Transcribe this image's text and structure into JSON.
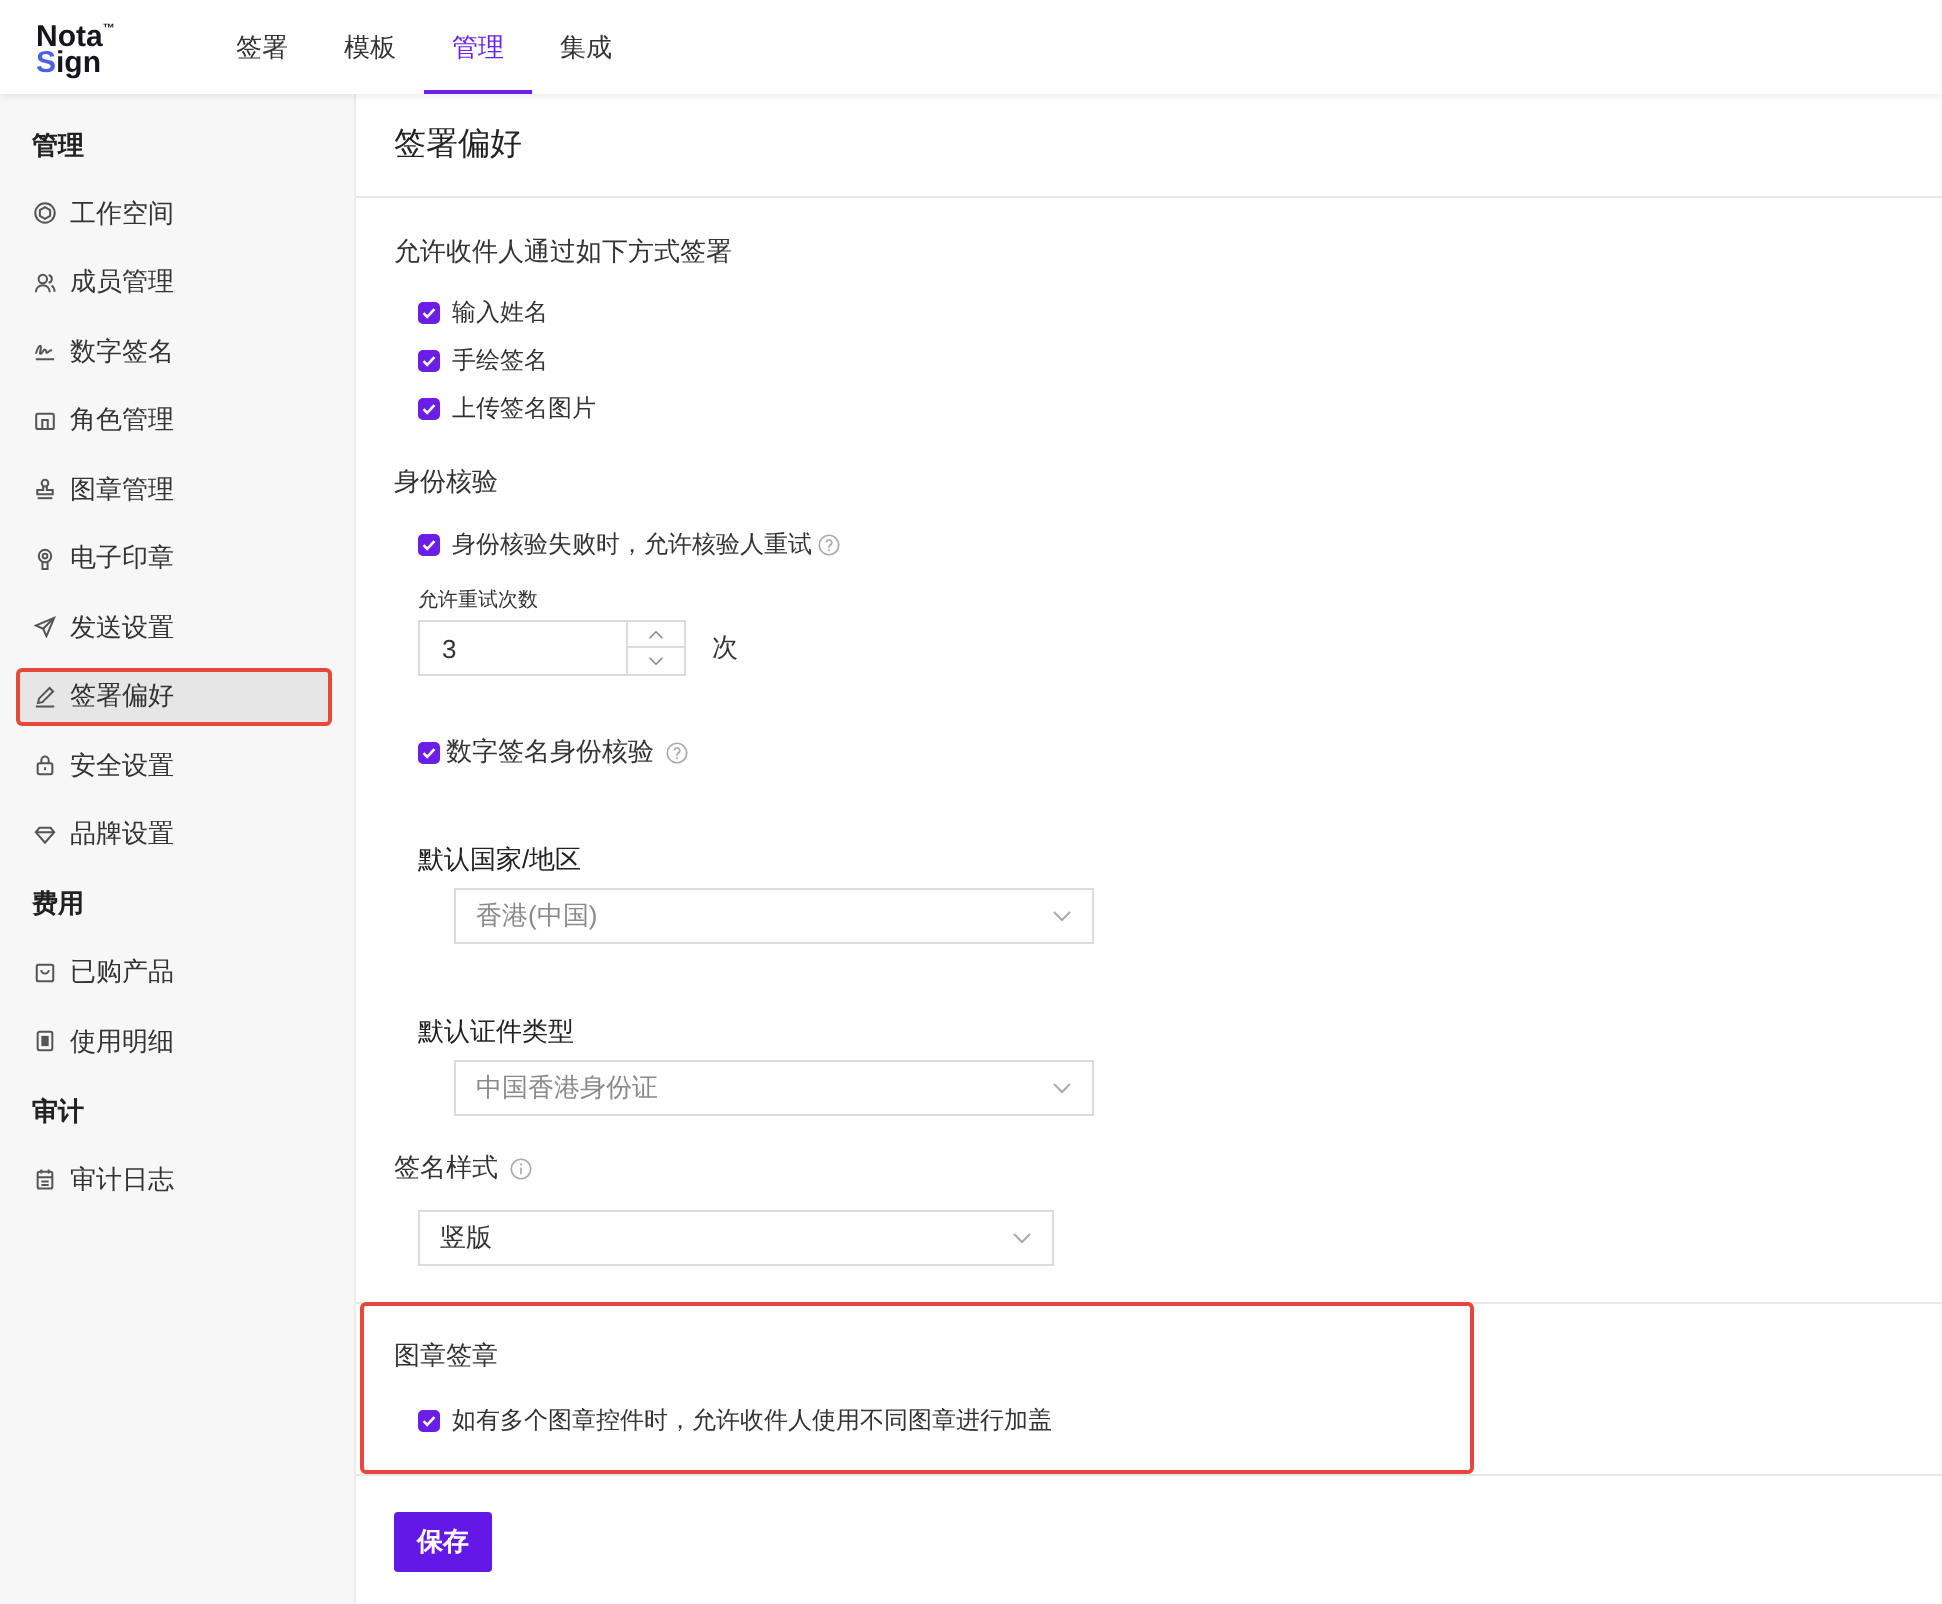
{
  "logo": {
    "line_1": "Nota$^{™}$",
    "line_2": "Sign"
  },
  "nav": [
    {
      "label": "签署",
      "selected": false
    },
    {
      "label": "模板",
      "selected": false
    },
    {
      "label": "管理",
      "selected": true
    },
    {
      "label": "集成",
      "selected": false
    }
  ],
  "sidebar": {
    "groups": [
      {
        "title": "管理",
        "items": [
          {
            "label": "工作空间",
            "selected": false,
            "highlighted": false
          },
          {
            "label": "成员管理",
            "selected": false,
            "highlighted": false
          },
          {
            "label": "数字签名",
            "selected": false,
            "highlighted": false
          },
          {
            "label": "角色管理",
            "selected": false,
            "highlighted": false
          },
          {
            "label": "图章管理",
            "selected": false,
            "highlighted": false
          },
          {
            "label": "电子印章",
            "selected": false,
            "highlighted": false
          },
          {
            "label": "发送设置",
            "selected": false,
            "highlighted": false
          },
          {
            "label": "签署偏好",
            "selected": true,
            "highlighted": true
          },
          {
            "label": "安全设置",
            "selected": false,
            "highlighted": false
          },
          {
            "label": "品牌设置",
            "selected": false,
            "highlighted": false
          }
        ]
      },
      {
        "title": "费用",
        "items": [
          {
            "label": "已购产品",
            "selected": false,
            "highlighted": false
          },
          {
            "label": "使用明细",
            "selected": false,
            "highlighted": false
          }
        ]
      },
      {
        "title": "审计",
        "items": [
          {
            "label": "审计日志",
            "selected": false,
            "highlighted": false
          }
        ]
      }
    ]
  },
  "page_title": "签署偏好",
  "signing_methods": {
    "heading": "允许收件人通过如下方式签署",
    "options": [
      {
        "label": "输入姓名",
        "checked": true
      },
      {
        "label": "手绘签名",
        "checked": true
      },
      {
        "label": "上传签名图片",
        "checked": true
      }
    ]
  },
  "identity": {
    "heading": "身份核验",
    "retry": {
      "label": "身份核验失败时，允许核验人重试",
      "checked": true
    },
    "retry_count": {
      "label": "允许重试次数",
      "value": "3",
      "unit": "次"
    },
    "digital_signature_check": {
      "label": "数字签名身份核验",
      "checked": true
    },
    "default_country": {
      "label": "默认国家/地区",
      "value": "香港(中国)",
      "disabled": true
    },
    "default_id_type": {
      "label": "默认证件类型",
      "value": "中国香港身份证",
      "disabled": true
    }
  },
  "signature_style": {
    "label": "签名样式",
    "value": "竖版",
    "disabled": false
  },
  "seal_signing": {
    "heading": "图章签章",
    "highlighted": true,
    "option": {
      "label": "如有多个图章控件时，允许收件人使用不同图章进行加盖",
      "checked": true
    }
  },
  "save_button": "保存"
}
